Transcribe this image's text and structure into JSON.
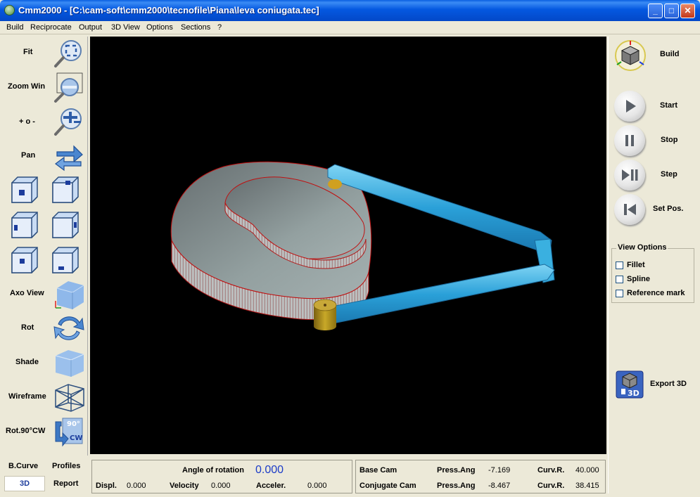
{
  "window": {
    "title": "Cmm2000 - [C:\\cam-soft\\cmm2000\\tecnofile\\Piana\\leva coniugata.tec]",
    "minimize": "_",
    "maximize": "□",
    "close": "✕"
  },
  "menu": [
    "Build",
    "Reciprocate",
    "Output",
    "3D View",
    "Options",
    "Sections",
    "?"
  ],
  "left_toolbar": {
    "fit": "Fit",
    "zoom_win": "Zoom Win",
    "zoom_pm": "+ o -",
    "pan": "Pan",
    "axo_view": "Axo View",
    "rot": "Rot",
    "shade": "Shade",
    "wireframe": "Wireframe",
    "rot90": "Rot.90°CW",
    "rot90_badge_top": "90°",
    "rot90_badge_bottom": "CW"
  },
  "right_panel": {
    "build": "Build",
    "start": "Start",
    "stop": "Stop",
    "step": "Step",
    "set_pos": "Set Pos.",
    "view_options_title": "View Options",
    "options": [
      "Fillet",
      "Spline",
      "Reference mark"
    ],
    "export_3d": "Export 3D",
    "export_badge": "3D"
  },
  "bottom_left": {
    "b_curve": "B.Curve",
    "profiles": "Profiles",
    "tab_3d": "3D",
    "report": "Report"
  },
  "readout": {
    "angle_label": "Angle of rotation",
    "angle_value": "0.000",
    "displ_label": "Displ.",
    "displ_value": "0.000",
    "velocity_label": "Velocity",
    "velocity_value": "0.000",
    "accel_label": "Acceler.",
    "accel_value": "0.000"
  },
  "cams": {
    "base_label": "Base Cam",
    "base_press_label": "Press.Ang",
    "base_press_value": "-7.169",
    "base_curv_label": "Curv.R.",
    "base_curv_value": "40.000",
    "conj_label": "Conjugate Cam",
    "conj_press_label": "Press.Ang",
    "conj_press_value": "-8.467",
    "conj_curv_label": "Curv.R.",
    "conj_curv_value": "38.415"
  },
  "colors": {
    "accent_blue": "#1c3cc8",
    "cam_gray": "#8a9494",
    "cam_edge": "#c01010",
    "lever_blue": "#2aa0d8",
    "roller_gold": "#b8961e"
  }
}
